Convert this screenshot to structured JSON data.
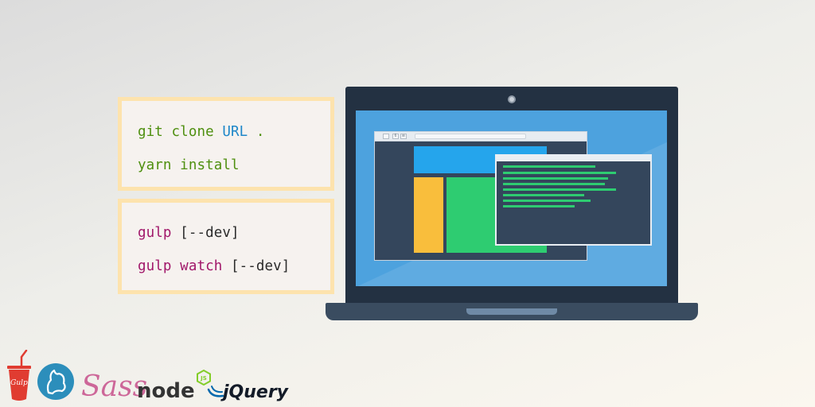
{
  "setup_box": {
    "line1": {
      "cmd": "git clone ",
      "arg": "URL",
      "rest": " ."
    },
    "line2": {
      "cmd": "yarn install"
    }
  },
  "build_box": {
    "line1": {
      "cmd": "gulp",
      "args": " [--dev]"
    },
    "line2": {
      "cmd": "gulp watch",
      "args": " [--dev]"
    }
  },
  "laptop": {
    "browser_tab_icons": [
      "6",
      "⊞"
    ]
  },
  "logos": {
    "gulp": "Gulp",
    "yarn": "yarn-logo",
    "sass": "Sass",
    "node": "node",
    "node_badge": "JS",
    "jquery": "jQuery"
  },
  "colors": {
    "code_green": "#4e8f0f",
    "code_blue": "#1e87c9",
    "code_magenta": "#a1176a",
    "box_border": "#fde3ad",
    "laptop_dark": "#233142",
    "screen_blue": "#4da2de",
    "terminal_green": "#2ecc71"
  }
}
